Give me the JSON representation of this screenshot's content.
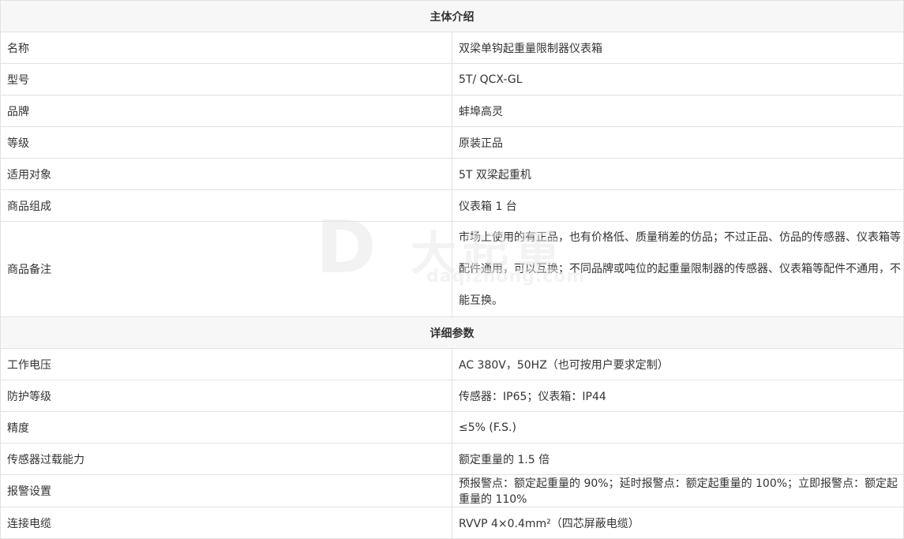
{
  "sections": [
    {
      "title": "主体介绍",
      "rows": [
        {
          "label": "名称",
          "value": "双梁单钩起重量限制器仪表箱"
        },
        {
          "label": "型号",
          "value": "5T/ QCX-GL"
        },
        {
          "label": "品牌",
          "value": "蚌埠高灵"
        },
        {
          "label": "等级",
          "value": "原装正品"
        },
        {
          "label": "适用对象",
          "value": "5T 双梁起重机"
        },
        {
          "label": "商品组成",
          "value": "仪表箱 1 台"
        },
        {
          "label": "商品备注",
          "value": "市场上使用的有正品，也有价格低、质量稍差的仿品；不过正品、仿品的传感器、仪表箱等配件通用，可以互换；不同品牌或吨位的起重量限制器的传感器、仪表箱等配件不通用，不能互换。"
        }
      ]
    },
    {
      "title": "详细参数",
      "rows": [
        {
          "label": "工作电压",
          "value": "AC 380V，50HZ（也可按用户要求定制）"
        },
        {
          "label": "防护等级",
          "value": "传感器：IP65；仪表箱：IP44"
        },
        {
          "label": "精度",
          "value": "≤5% (F.S.)"
        },
        {
          "label": "传感器过载能力",
          "value": "额定重量的 1.5 倍"
        },
        {
          "label": "报警设置",
          "value": "预报警点：额定起重量的 90%；延时报警点：额定起重量的 100%；立即报警点：额定起重量的 110%"
        },
        {
          "label": "连接电缆",
          "value": "RVVP 4×0.4mm²（四芯屏蔽电缆）"
        }
      ]
    }
  ],
  "watermark": {
    "letter": "D",
    "text": "大起重",
    "url": "daqizhong.com"
  }
}
